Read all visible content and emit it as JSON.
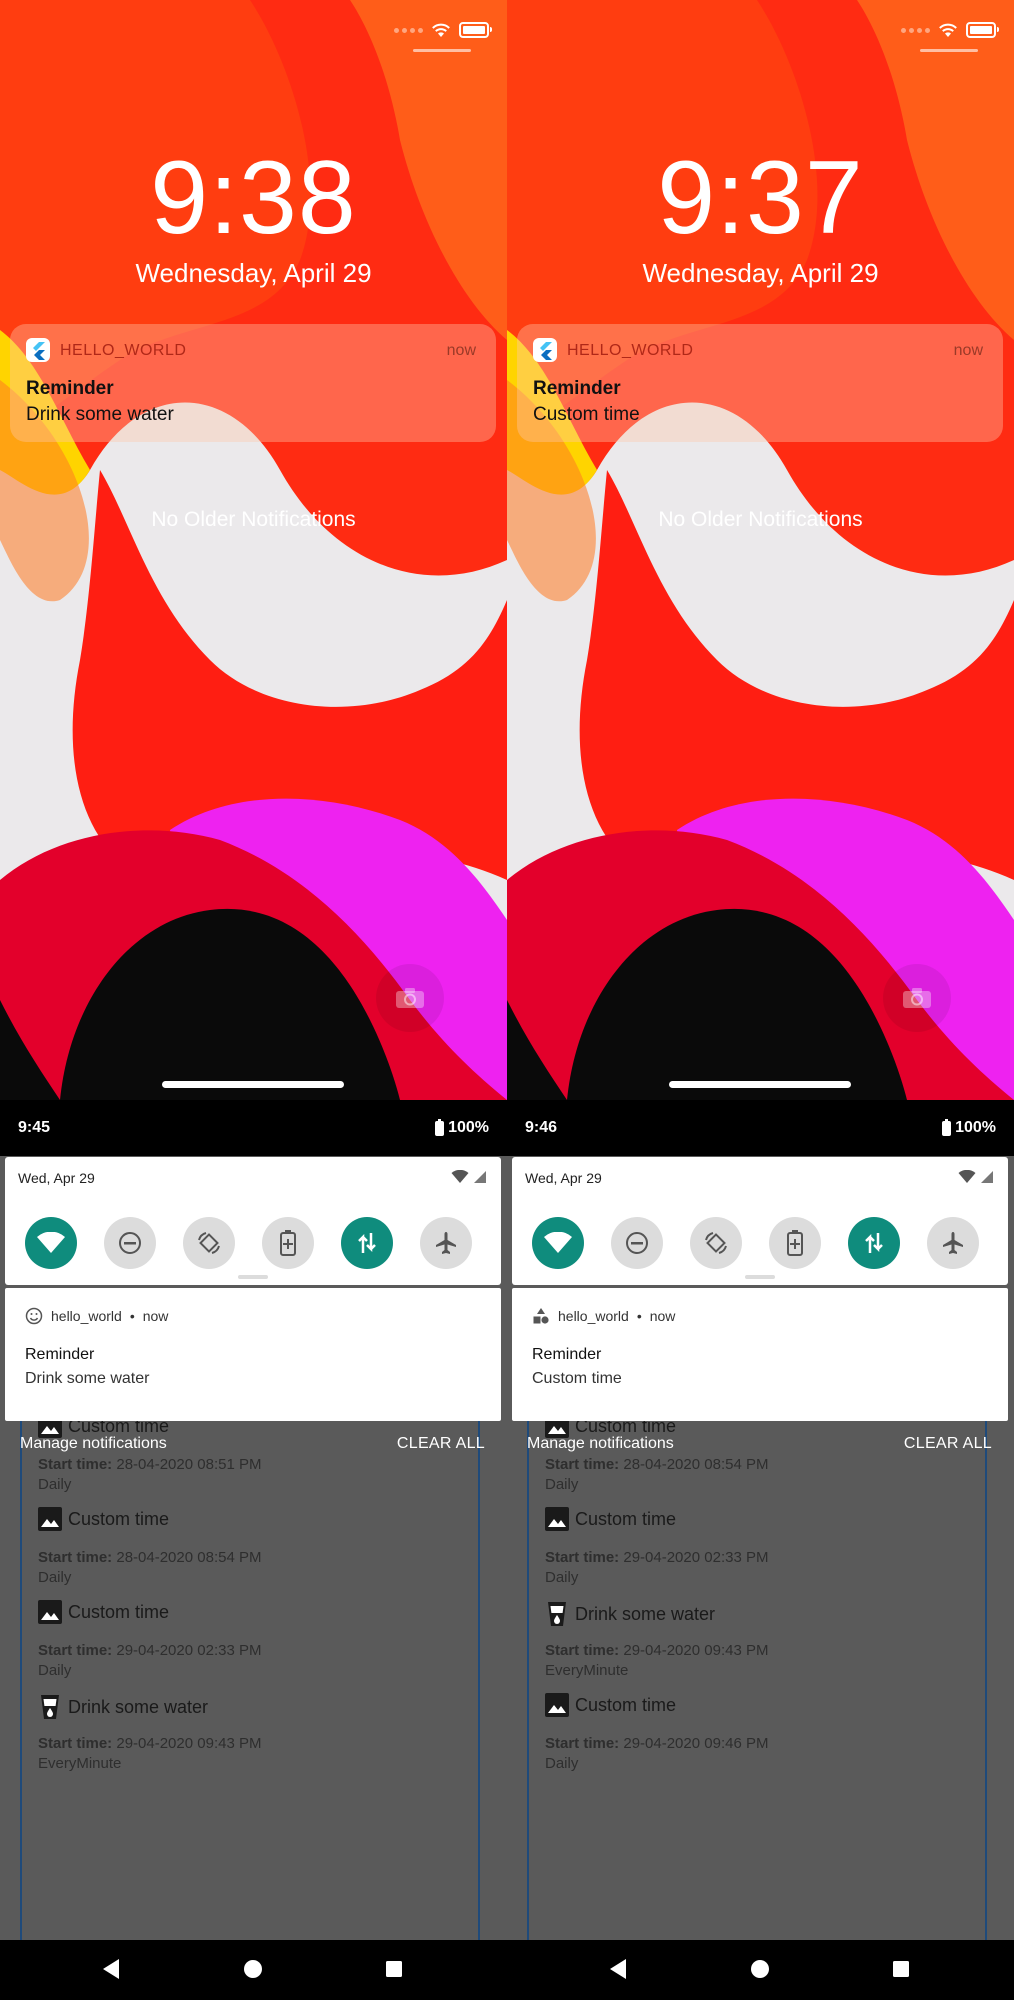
{
  "screens": [
    {
      "ios": {
        "clock": "9:38",
        "date": "Wednesday, April 29",
        "notification": {
          "app": "HELLO_WORLD",
          "time": "now",
          "title": "Reminder",
          "body": "Drink some water"
        },
        "no_older": "No Older Notifications"
      },
      "android": {
        "status_time": "9:45",
        "battery": "100%",
        "qs_date": "Wed, Apr 29",
        "notification": {
          "app": "hello_world",
          "time": "now",
          "title": "Reminder",
          "body": "Drink some water",
          "icon": "smiley-icon"
        },
        "manage": "Manage notifications",
        "clear_all": "CLEAR ALL",
        "items": [
          {
            "icon": "image-icon",
            "title": "Custom time",
            "start_label": "Start time:",
            "start": "28-04-2020 08:51 PM",
            "repeat": "Daily"
          },
          {
            "icon": "image-icon",
            "title": "Custom time",
            "start_label": "Start time:",
            "start": "28-04-2020 08:54 PM",
            "repeat": "Daily"
          },
          {
            "icon": "image-icon",
            "title": "Custom time",
            "start_label": "Start time:",
            "start": "29-04-2020 02:33 PM",
            "repeat": "Daily"
          },
          {
            "icon": "water-glass-icon",
            "title": "Drink some water",
            "start_label": "Start time:",
            "start": "29-04-2020 09:43 PM",
            "repeat": "EveryMinute"
          }
        ]
      }
    },
    {
      "ios": {
        "clock": "9:37",
        "date": "Wednesday, April 29",
        "notification": {
          "app": "HELLO_WORLD",
          "time": "now",
          "title": "Reminder",
          "body": "Custom time"
        },
        "no_older": "No Older Notifications"
      },
      "android": {
        "status_time": "9:46",
        "battery": "100%",
        "qs_date": "Wed, Apr 29",
        "notification": {
          "app": "hello_world",
          "time": "now",
          "title": "Reminder",
          "body": "Custom time",
          "icon": "shapes-icon"
        },
        "manage": "Manage notifications",
        "clear_all": "CLEAR ALL",
        "items": [
          {
            "icon": "image-icon",
            "title": "Custom time",
            "start_label": "Start time:",
            "start": "28-04-2020 08:54 PM",
            "repeat": "Daily"
          },
          {
            "icon": "image-icon",
            "title": "Custom time",
            "start_label": "Start time:",
            "start": "29-04-2020 02:33 PM",
            "repeat": "Daily"
          },
          {
            "icon": "water-glass-icon",
            "title": "Drink some water",
            "start_label": "Start time:",
            "start": "29-04-2020 09:43 PM",
            "repeat": "EveryMinute"
          },
          {
            "icon": "image-icon",
            "title": "Custom time",
            "start_label": "Start time:",
            "start": "29-04-2020 09:46 PM",
            "repeat": "Daily"
          }
        ]
      }
    }
  ],
  "colors": {
    "teal_tile": "#0f8c7d",
    "ios_app_name": "#b02818",
    "list_border": "#1f4a7a"
  }
}
